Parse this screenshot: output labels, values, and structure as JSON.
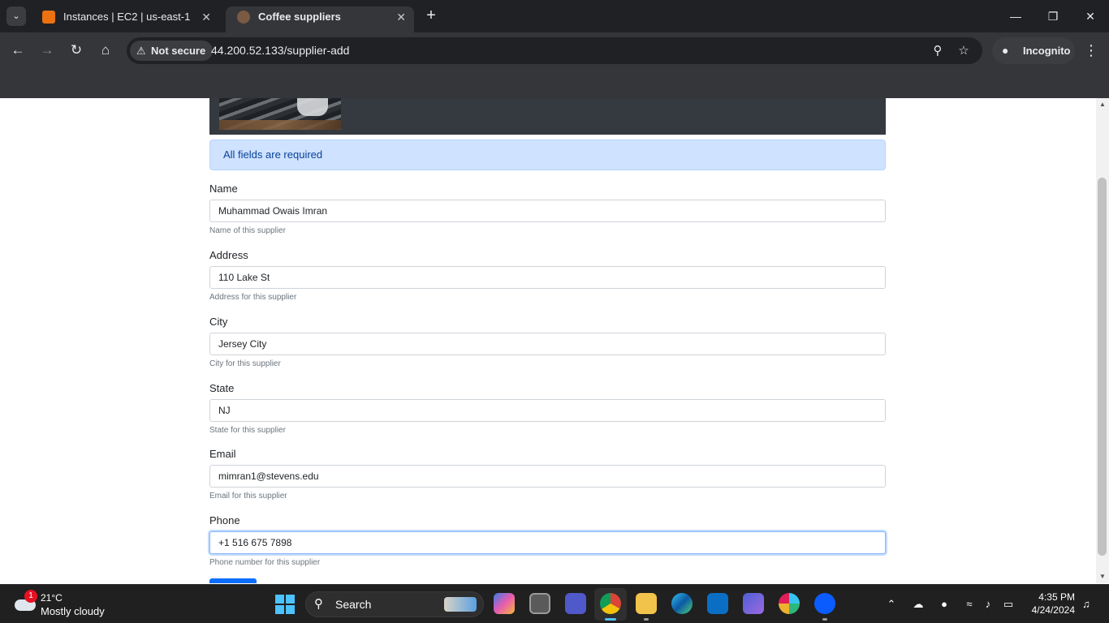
{
  "browser": {
    "tabs": [
      {
        "title": "Instances | EC2 | us-east-1",
        "active": false
      },
      {
        "title": "Coffee suppliers",
        "active": true
      }
    ],
    "security_label": "Not secure",
    "url": "44.200.52.133/supplier-add",
    "profile_label": "Incognito"
  },
  "page": {
    "alert": "All fields are required",
    "fields": [
      {
        "label": "Name",
        "value": "Muhammad Owais Imran",
        "help": "Name of this supplier"
      },
      {
        "label": "Address",
        "value": "110 Lake St",
        "help": "Address for this supplier"
      },
      {
        "label": "City",
        "value": "Jersey City",
        "help": "City for this supplier"
      },
      {
        "label": "State",
        "value": "NJ",
        "help": "State for this supplier"
      },
      {
        "label": "Email",
        "value": "mimran1@stevens.edu",
        "help": "Email for this supplier"
      },
      {
        "label": "Phone",
        "value": "+1 516 675 7898",
        "help": "Phone number for this supplier"
      }
    ]
  },
  "taskbar": {
    "weather": {
      "temp": "21°C",
      "condition": "Mostly cloudy",
      "badge": "1"
    },
    "search_label": "Search",
    "time": "4:35 PM",
    "date": "4/24/2024"
  },
  "colors": {
    "alert_bg": "#cfe2ff",
    "primary": "#0d6efd",
    "banner": "#343a40"
  }
}
